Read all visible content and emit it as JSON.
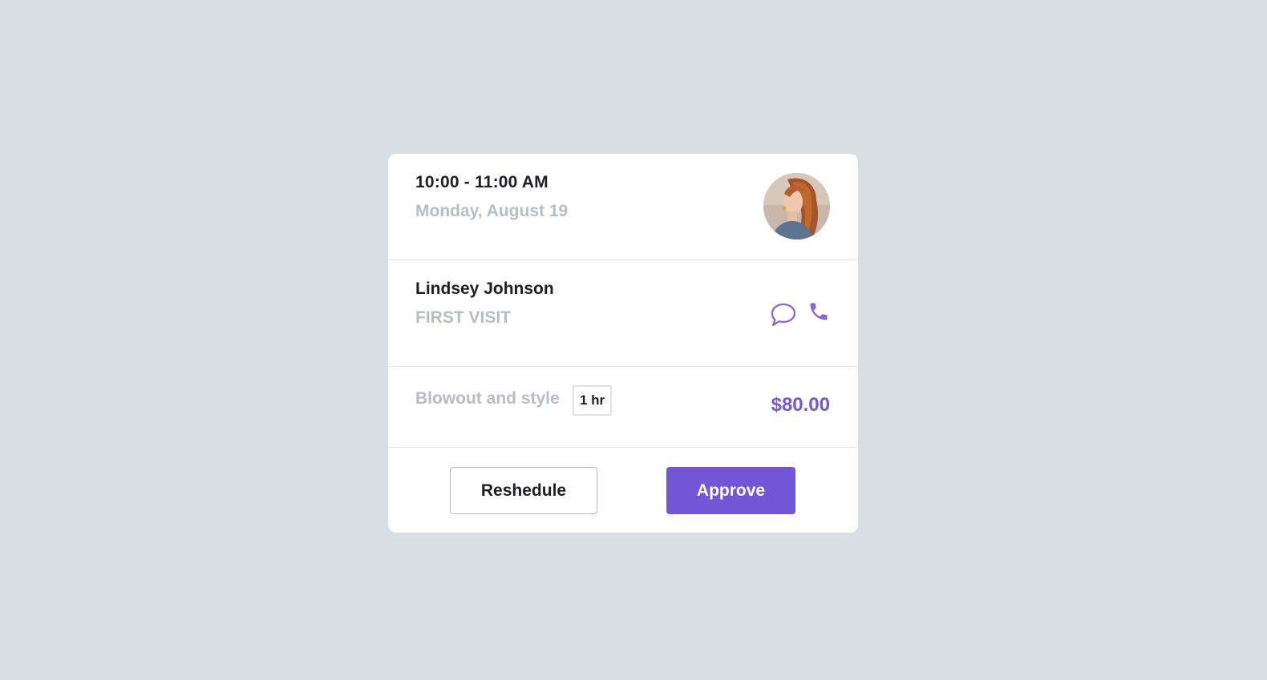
{
  "appointment": {
    "time_range": "10:00 - 11:00 AM",
    "date": "Monday, August 19"
  },
  "client": {
    "name": "Lindsey Johnson",
    "visit_type": "FIRST VISIT",
    "avatar_icon": "avatar-photo",
    "chat_icon": "chat-bubble-icon",
    "phone_icon": "phone-icon"
  },
  "service": {
    "name": "Blowout and style",
    "duration": "1 hr",
    "price": "$80.00"
  },
  "actions": {
    "reschedule_label": "Reshedule",
    "approve_label": "Approve"
  },
  "colors": {
    "background": "#d9dee5",
    "accent": "#7356d5",
    "price": "#7b55d6",
    "muted_text": "#b9bcc3",
    "primary_text": "#1d1f24"
  }
}
